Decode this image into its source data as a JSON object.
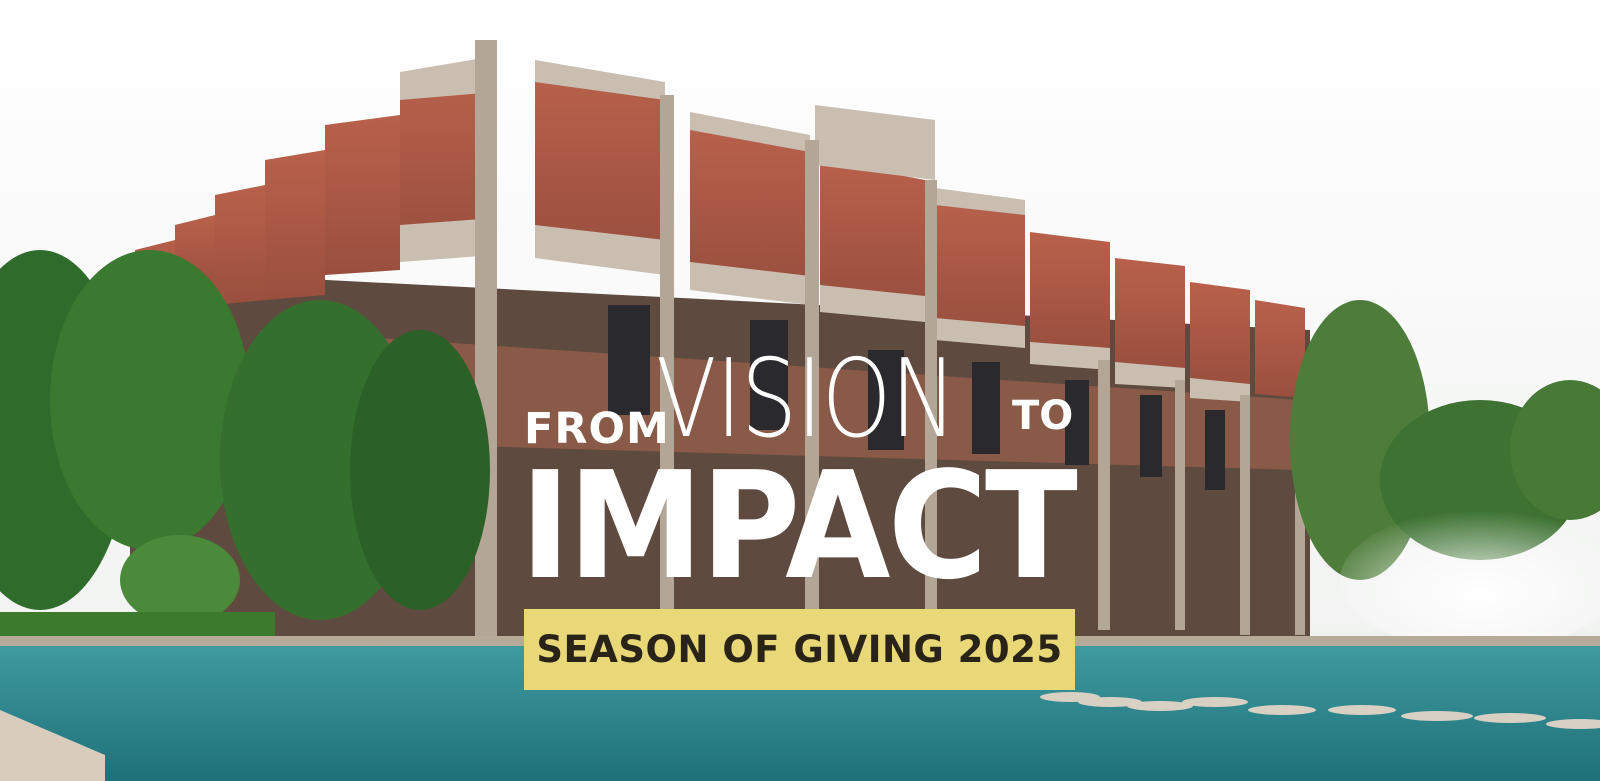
{
  "headline": {
    "from": "FROM",
    "vision": "VISION",
    "to": "TO",
    "impact": "IMPACT"
  },
  "banner": {
    "label": "SEASON OF GIVING 2025",
    "background": "#e8d878",
    "text_color": "#2a2418"
  },
  "colors": {
    "brick": "#a95a48",
    "concrete": "#bfb3a4",
    "foliage": "#2f6b2a",
    "water": "#2f8a91",
    "sky": "#ffffff"
  }
}
